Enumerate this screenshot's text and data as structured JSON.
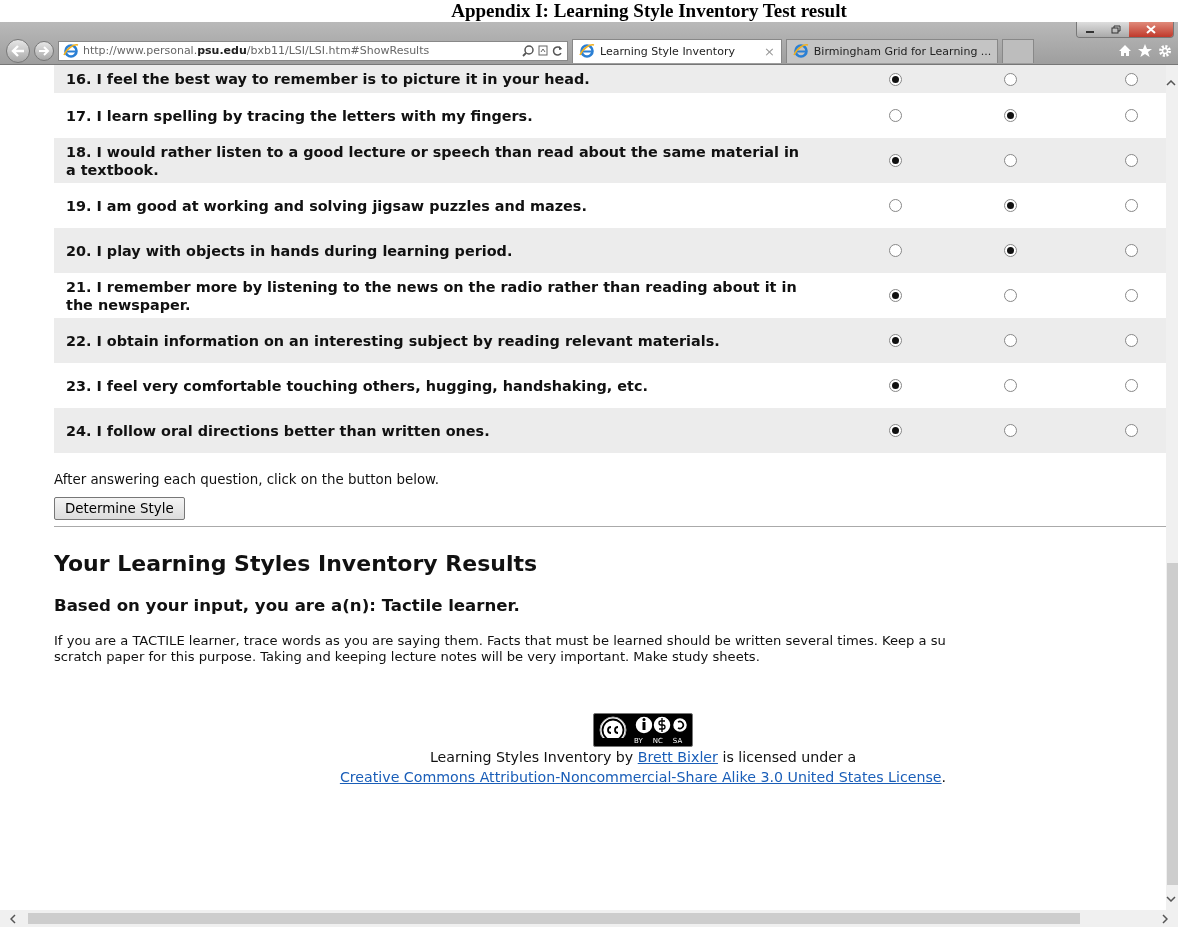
{
  "document_heading": "Appendix I: Learning Style Inventory Test result",
  "browser": {
    "address": "http://www.personal.**psu.edu**/bxb11/LSI/LSI.htm#ShowResults",
    "tabs": [
      {
        "label": "Learning Style Inventory",
        "selected": true,
        "close": "×"
      },
      {
        "label": "Birmingham Grid for Learning ...",
        "selected": false
      }
    ]
  },
  "questions": [
    {
      "text": "16. I feel the best way to remember is to picture it in your head.",
      "options": [
        {
          "selected": true
        },
        {
          "selected": false
        },
        {
          "selected": false
        }
      ]
    },
    {
      "text": "17. I learn spelling by tracing the letters with my fingers.",
      "options": [
        {
          "selected": false
        },
        {
          "selected": true
        },
        {
          "selected": false
        }
      ]
    },
    {
      "text": "18. I would rather listen to a good lecture or speech than read about the same material in a textbook.",
      "options": [
        {
          "selected": true
        },
        {
          "selected": false
        },
        {
          "selected": false
        }
      ]
    },
    {
      "text": "19. I am good at working and solving jigsaw puzzles and mazes.",
      "options": [
        {
          "selected": false
        },
        {
          "selected": true
        },
        {
          "selected": false
        }
      ]
    },
    {
      "text": "20. I play with objects in hands during learning period.",
      "options": [
        {
          "selected": false
        },
        {
          "selected": true
        },
        {
          "selected": false
        }
      ]
    },
    {
      "text": "21. I remember more by listening to the news on the radio rather than reading about it in the newspaper.",
      "options": [
        {
          "selected": true
        },
        {
          "selected": false
        },
        {
          "selected": false
        }
      ]
    },
    {
      "text": "22. I obtain information on an interesting subject by reading relevant materials.",
      "options": [
        {
          "selected": true
        },
        {
          "selected": false
        },
        {
          "selected": false
        }
      ]
    },
    {
      "text": "23. I feel very comfortable touching others, hugging, handshaking, etc.",
      "options": [
        {
          "selected": true
        },
        {
          "selected": false
        },
        {
          "selected": false
        }
      ]
    },
    {
      "text": "24. I follow oral directions better than written ones.",
      "options": [
        {
          "selected": true
        },
        {
          "selected": false
        },
        {
          "selected": false
        }
      ]
    }
  ],
  "instruction": "After answering each question, click on the button below.",
  "button": "Determine Style",
  "results": {
    "heading": "Your Learning Styles Inventory Results",
    "subheading": "Based on your input, you are a(n): Tactile learner.",
    "paragraph_lines": [
      "If you are a TACTILE learner, trace words as you are saying them. Facts that must be learned should be written several times. Keep a su",
      "scratch paper for this purpose. Taking and keeping lecture notes will be very important. Make study sheets."
    ]
  },
  "license": {
    "badge_labels": [
      "BY",
      "NC",
      "SA"
    ],
    "prefix": "Learning Styles Inventory by ",
    "author": "Brett Bixler",
    "middle": " is licensed under a",
    "license_link": "Creative Commons Attribution-Noncommercial-Share Alike 3.0 United States License",
    "suffix": "."
  }
}
